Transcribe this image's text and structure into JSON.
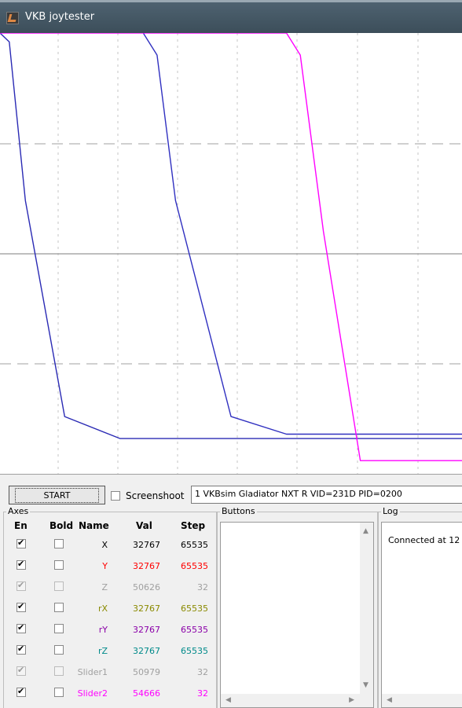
{
  "window": {
    "title": "VKB joytester"
  },
  "chart_data": {
    "type": "line",
    "series": [
      {
        "color": "#2a2ab4",
        "points": [
          [
            0,
            1.0
          ],
          [
            0.02,
            0.98
          ],
          [
            0.055,
            0.62
          ],
          [
            0.14,
            0.13
          ],
          [
            0.26,
            0.08
          ],
          [
            1.0,
            0.08
          ]
        ]
      },
      {
        "color": "#3030c0",
        "points": [
          [
            0.31,
            1.0
          ],
          [
            0.34,
            0.95
          ],
          [
            0.38,
            0.62
          ],
          [
            0.5,
            0.13
          ],
          [
            0.62,
            0.09
          ],
          [
            1.0,
            0.09
          ]
        ]
      },
      {
        "color": "#ff00ff",
        "points": [
          [
            0.0,
            1.0
          ],
          [
            0.62,
            1.0
          ],
          [
            0.65,
            0.95
          ],
          [
            0.7,
            0.55
          ],
          [
            0.78,
            0.03
          ],
          [
            1.0,
            0.03
          ]
        ]
      }
    ]
  },
  "toolbar": {
    "start_label": "START",
    "screenshot_label": "Screenshoot",
    "device": "1  VKBsim Gladiator NXT R   VID=231D PID=0200"
  },
  "axes_group": {
    "title": "Axes",
    "headers": {
      "en": "En",
      "bold": "Bold",
      "name": "Name",
      "val": "Val",
      "step": "Step"
    },
    "rows": [
      {
        "name": "X",
        "val": "32767",
        "step": "65535",
        "color": "#000000",
        "enabled": true,
        "disabled": false
      },
      {
        "name": "Y",
        "val": "32767",
        "step": "65535",
        "color": "#ff0000",
        "enabled": true,
        "disabled": false
      },
      {
        "name": "Z",
        "val": "50626",
        "step": "32",
        "color": "#a0a0a0",
        "enabled": true,
        "disabled": true
      },
      {
        "name": "rX",
        "val": "32767",
        "step": "65535",
        "color": "#8a8a00",
        "enabled": true,
        "disabled": false
      },
      {
        "name": "rY",
        "val": "32767",
        "step": "65535",
        "color": "#8a00a8",
        "enabled": true,
        "disabled": false
      },
      {
        "name": "rZ",
        "val": "32767",
        "step": "65535",
        "color": "#008a8a",
        "enabled": true,
        "disabled": false
      },
      {
        "name": "Slider1",
        "val": "50979",
        "step": "32",
        "color": "#a0a0a0",
        "enabled": true,
        "disabled": true
      },
      {
        "name": "Slider2",
        "val": "54666",
        "step": "32",
        "color": "#ff00ff",
        "enabled": true,
        "disabled": false
      }
    ]
  },
  "buttons_group": {
    "title": "Buttons"
  },
  "log_group": {
    "title": "Log",
    "text": "Connected at 12"
  }
}
